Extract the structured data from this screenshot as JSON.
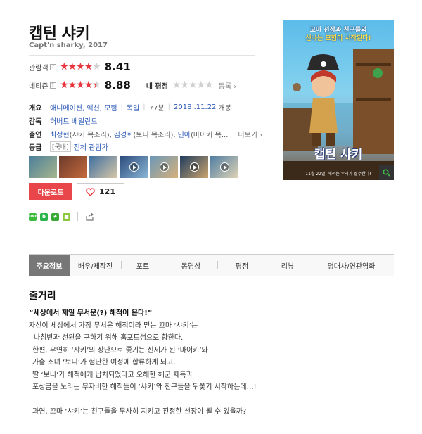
{
  "movie": {
    "title": "캡틴 샤키",
    "subtitle": "Capt'n sharky, 2017"
  },
  "ratings": {
    "audience": {
      "label": "관람객",
      "help": "?",
      "score": "8.41",
      "score_value": 8.41
    },
    "netizen": {
      "label": "네티즌",
      "help": "?",
      "score": "8.88",
      "score_value": 8.88
    },
    "my": {
      "label": "내 평점",
      "register": "등록 ›",
      "score_value": 0
    }
  },
  "info": {
    "overview": {
      "label": "개요",
      "genre": "애니메이션, 액션, 모험",
      "country": "독일",
      "runtime": "77분",
      "release_date": "2018 .11.22",
      "release_suffix": "개봉"
    },
    "director": {
      "label": "감독",
      "name": "허버트 베일란드"
    },
    "cast": {
      "label": "출연",
      "actor1": "최정현",
      "role1": "(샤키 목소리),",
      "actor2": "김경희",
      "role2": "(보니 목소리),",
      "actor3": "민아",
      "role3": "(마이키 목...",
      "more": "더보기 ›"
    },
    "rating": {
      "label": "등급",
      "region": "[국내]",
      "grade": "전체 관람가"
    }
  },
  "thumbnails": [
    {
      "kind": "photo",
      "icon": "none",
      "colors": [
        "#4a7f9b",
        "#a8b58c"
      ]
    },
    {
      "kind": "photo",
      "icon": "none",
      "colors": [
        "#6b3a2b",
        "#c66a3d"
      ]
    },
    {
      "kind": "photo",
      "icon": "none",
      "colors": [
        "#3f6fa0",
        "#d8c7a8"
      ]
    },
    {
      "kind": "video",
      "icon": "play-icon",
      "colors": [
        "#2a4a7a",
        "#8ab6d6"
      ]
    },
    {
      "kind": "video",
      "icon": "play-icon",
      "colors": [
        "#6b98b8",
        "#d7b07a"
      ]
    },
    {
      "kind": "video",
      "icon": "play-icon",
      "colors": [
        "#1f3d5e",
        "#caa46e"
      ]
    },
    {
      "kind": "video",
      "icon": "play-icon",
      "colors": [
        "#4f7ea3",
        "#e0d3b6"
      ]
    }
  ],
  "actions": {
    "download": "다운로드",
    "like_count": "121"
  },
  "share": {
    "icons": [
      "line-share-icon",
      "band-share-icon",
      "bookmark-star-icon",
      "checkbox-icon",
      "export-icon"
    ],
    "colors": {
      "line": "#3dbb3d",
      "band": "#29b34a",
      "star": "#35a835",
      "check": "#8ec63f"
    }
  },
  "poster": {
    "tagline_1": "꼬마 선장과 친구들의",
    "tagline_2": "신나는 모험이 시작된다!",
    "title": "캡틴 샤키",
    "footer": "11월 22일, 해적는 우리가 접수한다!"
  },
  "tabs": [
    {
      "label": "주요정보",
      "active": true
    },
    {
      "label": "배우/제작진",
      "active": false
    },
    {
      "label": "포토",
      "active": false
    },
    {
      "label": "동영상",
      "active": false
    },
    {
      "label": "평점",
      "active": false
    },
    {
      "label": "리뷰",
      "active": false
    },
    {
      "label": "명대사/연관영화",
      "active": false
    }
  ],
  "synopsis": {
    "heading": "줄거리",
    "tagline": "“세상에서 제일 무서운(?) 해적이 온다!”",
    "lines": [
      "자신이 세상에서 가장 무서운 해적이라 믿는 꼬마 ‘샤키’는",
      "나침반과 선원을 구하기 위해 홈포트섬으로 향한다.",
      "한편, 우연히 ‘샤키’의 장난으로 쫓기는 신세가 된 ‘마이키’와",
      "가출 소녀 ‘보니’가 험난한 여정에 합류하게 되고,",
      "딸 ‘보니’가 해적에게 납치되었다고 오해한 해군 제독과",
      "포상금을 노리는 무자비한 해적들이 ‘샤키’와 친구들을 뒤쫓기 시작하는데…!",
      "",
      "과연, 꼬마 ‘샤키’는 친구들을 무사히 지키고 진정한 선장이 될 수 있을까?"
    ]
  },
  "colors": {
    "accent_red": "#e8333a",
    "link_blue": "#2a58b6",
    "tab_active": "#777777"
  }
}
